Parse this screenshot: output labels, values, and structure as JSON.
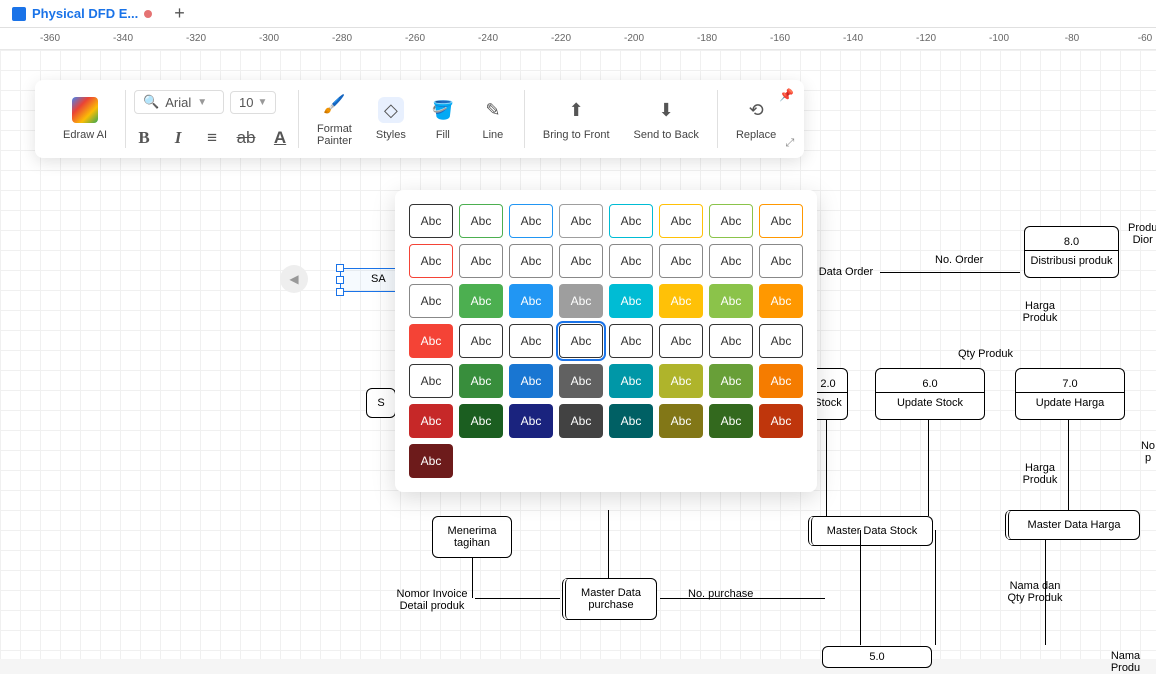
{
  "tab": {
    "title": "Physical DFD E..."
  },
  "ruler": {
    "ticks": [
      "-360",
      "-340",
      "-320",
      "-300",
      "-280",
      "-260",
      "-240",
      "-220",
      "-200",
      "-180",
      "-160",
      "-140",
      "-120",
      "-100",
      "-80",
      "-60"
    ]
  },
  "toolbar": {
    "edraw_ai": "Edraw AI",
    "font_name": "Arial",
    "font_size": "10",
    "format_painter": "Format\nPainter",
    "styles": "Styles",
    "fill": "Fill",
    "line": "Line",
    "bring_front": "Bring to Front",
    "send_back": "Send to Back",
    "replace": "Replace"
  },
  "styles_popup": {
    "label": "Abc",
    "rows": [
      [
        {
          "bg": "#fff",
          "bd": "#333",
          "fg": "#333"
        },
        {
          "bg": "#fff",
          "bd": "#4caf50",
          "fg": "#333"
        },
        {
          "bg": "#fff",
          "bd": "#2196f3",
          "fg": "#333"
        },
        {
          "bg": "#fff",
          "bd": "#9e9e9e",
          "fg": "#333"
        },
        {
          "bg": "#fff",
          "bd": "#00bcd4",
          "fg": "#333"
        },
        {
          "bg": "#fff",
          "bd": "#ffc107",
          "fg": "#333"
        },
        {
          "bg": "#fff",
          "bd": "#8bc34a",
          "fg": "#333"
        },
        {
          "bg": "#fff",
          "bd": "#ff9800",
          "fg": "#333"
        },
        {
          "bg": "#fff",
          "bd": "#f44336",
          "fg": "#333"
        }
      ],
      [
        {
          "bg": "#fff",
          "bd": "#888",
          "fg": "#333"
        },
        {
          "bg": "#fff",
          "bd": "#888",
          "fg": "#333"
        },
        {
          "bg": "#fff",
          "bd": "#888",
          "fg": "#333"
        },
        {
          "bg": "#fff",
          "bd": "#888",
          "fg": "#333"
        },
        {
          "bg": "#fff",
          "bd": "#888",
          "fg": "#333"
        },
        {
          "bg": "#fff",
          "bd": "#888",
          "fg": "#333"
        },
        {
          "bg": "#fff",
          "bd": "#888",
          "fg": "#333"
        },
        {
          "bg": "#fff",
          "bd": "#888",
          "fg": "#333"
        }
      ],
      [
        {
          "bg": "#4caf50",
          "fg": "#fff"
        },
        {
          "bg": "#2196f3",
          "fg": "#fff"
        },
        {
          "bg": "#9e9e9e",
          "fg": "#fff"
        },
        {
          "bg": "#00bcd4",
          "fg": "#fff"
        },
        {
          "bg": "#ffc107",
          "fg": "#fff"
        },
        {
          "bg": "#8bc34a",
          "fg": "#fff"
        },
        {
          "bg": "#ff9800",
          "fg": "#fff"
        },
        {
          "bg": "#f44336",
          "fg": "#fff"
        }
      ],
      [
        {
          "bg": "#fff",
          "bd": "#333",
          "fg": "#333"
        },
        {
          "bg": "#fff",
          "bd": "#333",
          "fg": "#333"
        },
        {
          "bg": "#fff",
          "bd": "#333",
          "fg": "#333",
          "sel": true
        },
        {
          "bg": "#fff",
          "bd": "#333",
          "fg": "#333"
        },
        {
          "bg": "#fff",
          "bd": "#333",
          "fg": "#333"
        },
        {
          "bg": "#fff",
          "bd": "#333",
          "fg": "#333"
        },
        {
          "bg": "#fff",
          "bd": "#333",
          "fg": "#333"
        },
        {
          "bg": "#fff",
          "bd": "#333",
          "fg": "#333"
        }
      ],
      [
        {
          "bg": "#388e3c",
          "fg": "#fff"
        },
        {
          "bg": "#1976d2",
          "fg": "#fff"
        },
        {
          "bg": "#616161",
          "fg": "#fff"
        },
        {
          "bg": "#0097a7",
          "fg": "#fff"
        },
        {
          "bg": "#afb42b",
          "fg": "#fff"
        },
        {
          "bg": "#689f38",
          "fg": "#fff"
        },
        {
          "bg": "#f57c00",
          "fg": "#fff"
        },
        {
          "bg": "#c62828",
          "fg": "#fff"
        }
      ],
      [
        {
          "bg": "#1b5e20",
          "fg": "#fff"
        },
        {
          "bg": "#1a237e",
          "fg": "#fff"
        },
        {
          "bg": "#424242",
          "fg": "#fff"
        },
        {
          "bg": "#006064",
          "fg": "#fff"
        },
        {
          "bg": "#827717",
          "fg": "#fff"
        },
        {
          "bg": "#33691e",
          "fg": "#fff"
        },
        {
          "bg": "#bf360c",
          "fg": "#fff"
        },
        {
          "bg": "#6d1b1b",
          "fg": "#fff"
        }
      ]
    ]
  },
  "diagram": {
    "selected_text": "SA",
    "boxes": {
      "b20": {
        "num": "2.0",
        "label": "Stock"
      },
      "b50": {
        "num": "5.0"
      },
      "b60": {
        "num": "6.0",
        "label": "Update Stock"
      },
      "b70": {
        "num": "7.0",
        "label": "Update Harga"
      },
      "b80": {
        "num": "8.0",
        "label": "Distribusi produk"
      },
      "menerima": "Menerima tagihan",
      "master_purchase": "Master Data purchase",
      "master_stock": "Master Data Stock",
      "master_harga": "Master Data Harga"
    },
    "labels": {
      "data_order": "r Data Order",
      "no_order": "No. Order",
      "harga_produk": "Harga Produk",
      "qty_produk": "Qty Produk",
      "harga_produk2": "Harga Produk",
      "no_purchase": "No. purchase",
      "nama_qty": "Nama dan Qty Produk",
      "invoice": "Nomor Invoice Detail produk",
      "produk_diorder": "Produ Dior",
      "no": "No p",
      "nama_produ": "Nama Produ",
      "s": "S"
    }
  }
}
